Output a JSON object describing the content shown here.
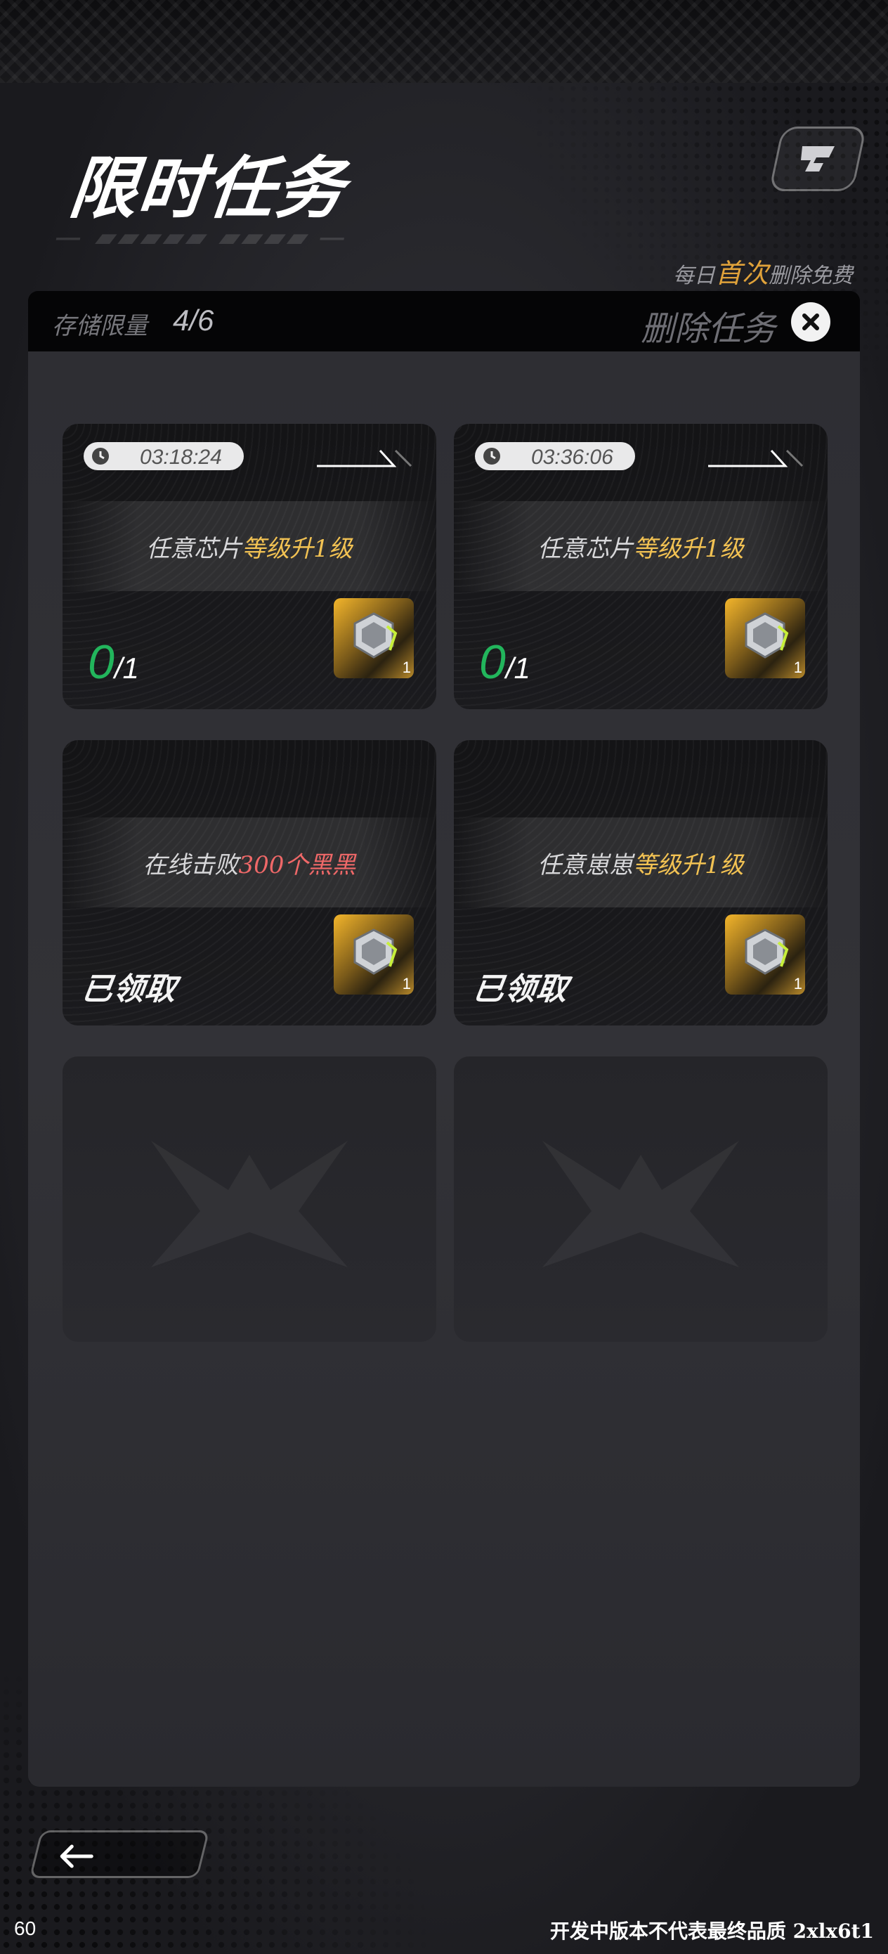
{
  "header": {
    "title": "限时任务",
    "free_note_prefix": "每日",
    "free_note_highlight": "首次",
    "free_note_suffix": "删除免费"
  },
  "storage": {
    "label": "存储限量",
    "count": "4/6",
    "delete_label": "删除任务"
  },
  "tasks": [
    {
      "timer": "03:18:24",
      "text_prefix": "任意芯片",
      "text_highlight": "等级升1级",
      "progress_current": "0",
      "progress_total": "/1",
      "reward_qty": "1"
    },
    {
      "timer": "03:36:06",
      "text_prefix": "任意芯片",
      "text_highlight": "等级升1级",
      "progress_current": "0",
      "progress_total": "/1",
      "reward_qty": "1"
    },
    {
      "text_prefix": "在线击败",
      "text_highlight": "300个黑黑",
      "status": "已领取",
      "reward_qty": "1"
    },
    {
      "text_prefix": "任意崽崽",
      "text_highlight": "等级升1级",
      "status": "已领取",
      "reward_qty": "1"
    }
  ],
  "footer": {
    "fps": "60",
    "build_note": "开发中版本不代表最终品质 2xlx6t1"
  },
  "colors": {
    "accent_gold": "#f2c253",
    "accent_red": "#ef6868",
    "progress_green": "#22b55c",
    "highlight_orange": "#e0a23a"
  },
  "icons": {
    "logo": "brand-logo-icon",
    "delete": "close-icon",
    "timer": "clock-icon",
    "reward": "chip-icon",
    "back": "arrow-left-icon"
  }
}
